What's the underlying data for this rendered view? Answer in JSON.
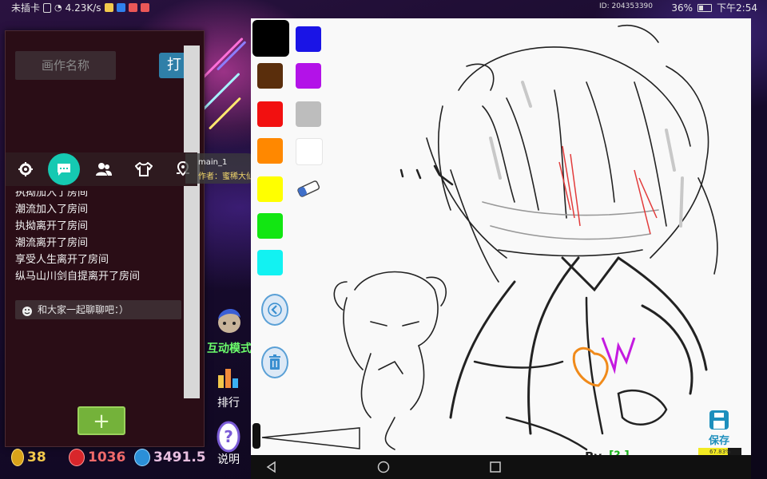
{
  "status_bar": {
    "carrier": "未插卡",
    "speed": "4.23K/s",
    "id": "ID: 204353390",
    "battery": "36%",
    "time": "下午2:54"
  },
  "left_panel": {
    "name_placeholder": "画作名称",
    "open_button": "打开",
    "chat_messages": [
      "执拗加入了房间",
      "潮流加入了房间",
      "执拗离开了房间",
      "潮流离开了房间",
      "享受人生离开了房间",
      "纵马山川剑自提离开了房间"
    ],
    "chat_placeholder": "和大家一起聊聊吧：）",
    "add_button": "+",
    "currency": {
      "gold": "38",
      "red": "1036",
      "blue": "3491.5"
    }
  },
  "user_info": {
    "room": "main_1",
    "author_label": "作者：",
    "author": "蜜稀大仙"
  },
  "side_menu": {
    "interactive_mode": "互动模式",
    "ranking": "排行",
    "help": "说明"
  },
  "palette": {
    "colors": [
      "#000000",
      "#1a14e6",
      "#5a2e0c",
      "#b312e8",
      "#f21010",
      "#bdbdbd",
      "#ff8800",
      "#ffffff",
      "#ffff00",
      "#12e612",
      "#12f2f2"
    ]
  },
  "canvas": {
    "save_label": "保存",
    "progress_text": "67.83%",
    "progress_value": 67.83,
    "by_label": "By",
    "by_name": "[? ]"
  },
  "icons": {
    "settings": "gear-icon",
    "chat": "chat-icon",
    "users": "users-icon",
    "shirt": "shirt-icon",
    "location": "location-icon",
    "eraser": "eraser-icon",
    "back": "back-arrow-icon",
    "trash": "trash-icon",
    "save": "save-icon"
  }
}
